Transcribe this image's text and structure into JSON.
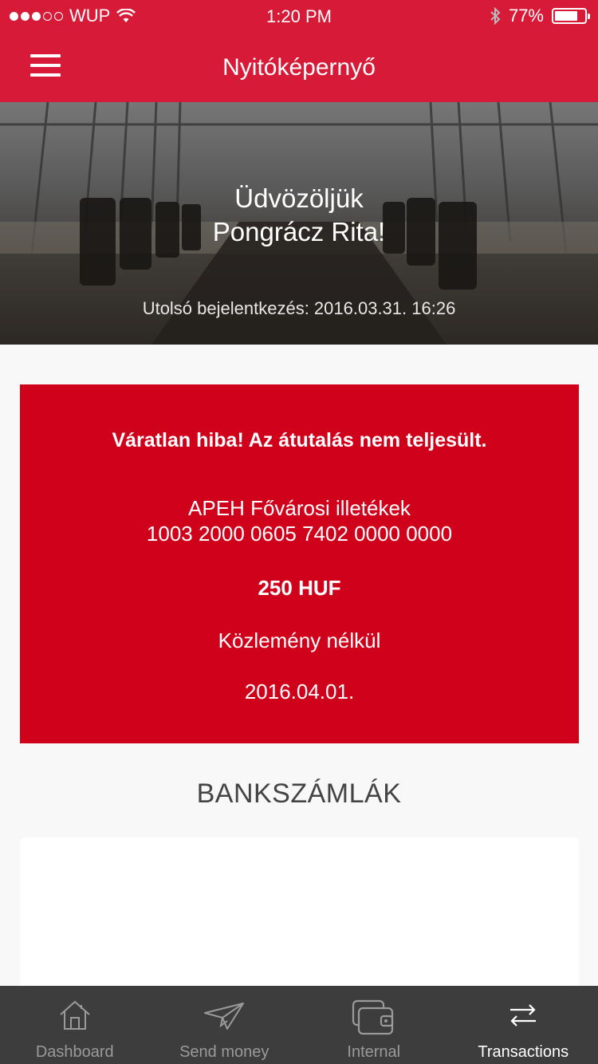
{
  "status_bar": {
    "carrier": "WUP",
    "time": "1:20 PM",
    "battery_percent": "77%",
    "battery_level": 0.77,
    "signal_bars_filled": 3,
    "signal_bars_total": 5
  },
  "header": {
    "title": "Nyitóképernyő",
    "background_color": "#d71a37"
  },
  "hero": {
    "greeting_line1": "Üdvözöljük",
    "greeting_line2": "Pongrácz Rita!",
    "last_login": "Utolsó bejelentkezés: 2016.03.31. 16:26"
  },
  "error_card": {
    "background_color": "#d0021b",
    "title": "Váratlan hiba! Az átutalás nem teljesült.",
    "payee": "APEH Fővárosi illetékek",
    "account_number": "1003 2000 0605 7402 0000 0000",
    "amount": "250 HUF",
    "note": "Közlemény nélkül",
    "date": "2016.04.01."
  },
  "accounts_section": {
    "title": "BANKSZÁMLÁK"
  },
  "tabbar": {
    "tabs": [
      {
        "label": "Dashboard",
        "icon": "home-icon"
      },
      {
        "label": "Send money",
        "icon": "paper-plane-icon"
      },
      {
        "label": "Internal",
        "icon": "wallet-icon"
      },
      {
        "label": "Transactions",
        "icon": "transfer-arrows-icon",
        "active": true
      }
    ]
  }
}
